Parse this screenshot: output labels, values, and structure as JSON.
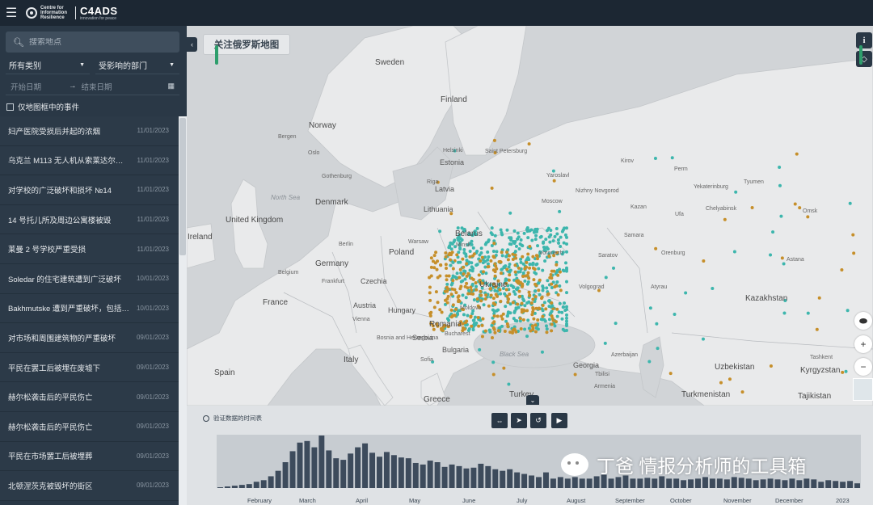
{
  "header": {
    "org_logo_text": "Centre for Information Resilience",
    "brand_name": "C4ADS",
    "brand_tagline": "innovation for peace"
  },
  "sidebar": {
    "search_placeholder": "搜索地点",
    "category_label": "所有类别",
    "sector_label": "受影响的部门",
    "start_date_placeholder": "开始日期",
    "end_date_placeholder": "结束日期",
    "map_only_label": "仅地图框中的事件",
    "events": [
      {
        "title": "妇产医院受损后并起的浓烟",
        "date": "11/01/2023"
      },
      {
        "title": "乌克兰 M113 无人机从索莱达尔一…",
        "date": "11/01/2023"
      },
      {
        "title": "对学校的广泛破坏和损坏 №14",
        "date": "11/01/2023"
      },
      {
        "title": "14 号托儿所及周边公寓楼被毁",
        "date": "11/01/2023"
      },
      {
        "title": "莱曼 2 号学校严重受损",
        "date": "11/01/2023"
      },
      {
        "title": "Soledar 的住宅建筑遭到广泛破坏",
        "date": "10/01/2023"
      },
      {
        "title": "Bakhmutske 遭到严重破坏，包括一…",
        "date": "10/01/2023"
      },
      {
        "title": "对市场和周围建筑物的严重破坏",
        "date": "09/01/2023"
      },
      {
        "title": "平民在罢工后被埋在废墟下",
        "date": "09/01/2023"
      },
      {
        "title": "赫尔松袭击后的平民伤亡",
        "date": "09/01/2023"
      },
      {
        "title": "赫尔松袭击后的平民伤亡",
        "date": "09/01/2023"
      },
      {
        "title": "平民在市场罢工后被埋葬",
        "date": "09/01/2023"
      },
      {
        "title": "北顿涅茨克被毁坏的街区",
        "date": "09/01/2023"
      }
    ]
  },
  "map": {
    "title": "关注俄罗斯地图",
    "labels": [
      {
        "name": "Sweden",
        "cls": "big"
      },
      {
        "name": "Finland",
        "cls": "big"
      },
      {
        "name": "Norway",
        "cls": "big"
      },
      {
        "name": "Estonia",
        "cls": ""
      },
      {
        "name": "Latvia",
        "cls": ""
      },
      {
        "name": "Lithuania",
        "cls": ""
      },
      {
        "name": "Denmark",
        "cls": "big"
      },
      {
        "name": "United Kingdom",
        "cls": "big"
      },
      {
        "name": "Poland",
        "cls": "big"
      },
      {
        "name": "Germany",
        "cls": "big"
      },
      {
        "name": "Belarus",
        "cls": "big"
      },
      {
        "name": "Ukraine",
        "cls": "big"
      },
      {
        "name": "France",
        "cls": "big"
      },
      {
        "name": "Romania",
        "cls": "big"
      },
      {
        "name": "Hungary",
        "cls": ""
      },
      {
        "name": "Austria",
        "cls": ""
      },
      {
        "name": "Czechia",
        "cls": ""
      },
      {
        "name": "Moldova",
        "cls": "small"
      },
      {
        "name": "Italy",
        "cls": "big"
      },
      {
        "name": "Spain",
        "cls": "big"
      },
      {
        "name": "Greece",
        "cls": "big"
      },
      {
        "name": "Turkey",
        "cls": "big"
      },
      {
        "name": "Georgia",
        "cls": ""
      },
      {
        "name": "Kazakhstan",
        "cls": "big"
      },
      {
        "name": "Uzbekistan",
        "cls": "big"
      },
      {
        "name": "Turkmenistan",
        "cls": "big"
      },
      {
        "name": "Kyrgyzstan",
        "cls": "big"
      },
      {
        "name": "Tajikistan",
        "cls": "big"
      },
      {
        "name": "Ireland",
        "cls": "big"
      },
      {
        "name": "Bulgaria",
        "cls": ""
      },
      {
        "name": "Serbia",
        "cls": ""
      },
      {
        "name": "Bosnia and Herzegovina",
        "cls": "small"
      },
      {
        "name": "North Sea",
        "cls": "sea"
      },
      {
        "name": "Black Sea",
        "cls": "sea"
      },
      {
        "name": "Saint Petersburg",
        "cls": "small"
      },
      {
        "name": "Moscow",
        "cls": "small"
      },
      {
        "name": "Voronezh",
        "cls": "small"
      },
      {
        "name": "Volgograd",
        "cls": "small"
      },
      {
        "name": "Samara",
        "cls": "small"
      },
      {
        "name": "Kazan",
        "cls": "small"
      },
      {
        "name": "Perm",
        "cls": "small"
      },
      {
        "name": "Yekaterinburg",
        "cls": "small"
      },
      {
        "name": "Tyumen",
        "cls": "small"
      },
      {
        "name": "Ufa",
        "cls": "small"
      },
      {
        "name": "Chelyabinsk",
        "cls": "small"
      },
      {
        "name": "Omsk",
        "cls": "small"
      },
      {
        "name": "Orenburg",
        "cls": "small"
      },
      {
        "name": "Saratov",
        "cls": "small"
      },
      {
        "name": "Astana",
        "cls": "small"
      },
      {
        "name": "Atyrau",
        "cls": "small"
      },
      {
        "name": "Kirov",
        "cls": "small"
      },
      {
        "name": "Yaroslavl",
        "cls": "small"
      },
      {
        "name": "Nizhny Novgorod",
        "cls": "small"
      },
      {
        "name": "Berlin",
        "cls": "small"
      },
      {
        "name": "Warsaw",
        "cls": "small"
      },
      {
        "name": "Vienna",
        "cls": "small"
      },
      {
        "name": "Frankfurt",
        "cls": "small"
      },
      {
        "name": "Belgium",
        "cls": "small"
      },
      {
        "name": "Minsk",
        "cls": "small"
      },
      {
        "name": "Bergen",
        "cls": "small"
      },
      {
        "name": "Oslo",
        "cls": "small"
      },
      {
        "name": "Helsinki",
        "cls": "small"
      },
      {
        "name": "Riga",
        "cls": "small"
      },
      {
        "name": "Gothenburg",
        "cls": "small"
      },
      {
        "name": "Tbilisi",
        "cls": "small"
      },
      {
        "name": "Azerbaijan",
        "cls": "small"
      },
      {
        "name": "Armenia",
        "cls": "small"
      },
      {
        "name": "Tashkent",
        "cls": "small"
      },
      {
        "name": "Sofia",
        "cls": "small"
      },
      {
        "name": "Bucharest",
        "cls": "small"
      }
    ]
  },
  "timeline": {
    "title": "验证数据的时间表",
    "months": [
      "February",
      "March",
      "April",
      "May",
      "June",
      "July",
      "August",
      "September",
      "October",
      "November",
      "December",
      "2023"
    ],
    "chart_data": {
      "type": "bar",
      "title": "验证数据的时间表",
      "xlabel": "",
      "ylabel": "",
      "values": [
        1,
        2,
        3,
        4,
        5,
        8,
        10,
        15,
        22,
        33,
        47,
        58,
        60,
        52,
        67,
        48,
        38,
        36,
        44,
        52,
        57,
        45,
        40,
        46,
        42,
        39,
        38,
        32,
        30,
        35,
        33,
        27,
        30,
        28,
        25,
        26,
        31,
        28,
        24,
        22,
        24,
        20,
        18,
        16,
        14,
        20,
        12,
        14,
        12,
        14,
        12,
        12,
        15,
        17,
        12,
        14,
        16,
        12,
        12,
        13,
        12,
        15,
        12,
        12,
        10,
        11,
        12,
        14,
        12,
        12,
        11,
        14,
        13,
        12,
        10,
        11,
        12,
        11,
        10,
        12,
        10,
        12,
        11,
        8,
        10,
        9,
        8,
        9,
        6
      ]
    }
  },
  "watermark": {
    "text": "丁爸 情报分析师的工具箱"
  },
  "colors": {
    "sidebar_bg": "#2a3846",
    "map_bg": "#d7d9dc",
    "teal_events": "#3db6ad",
    "gold_events": "#c68f2a",
    "bar_color": "#3d4b5c"
  }
}
